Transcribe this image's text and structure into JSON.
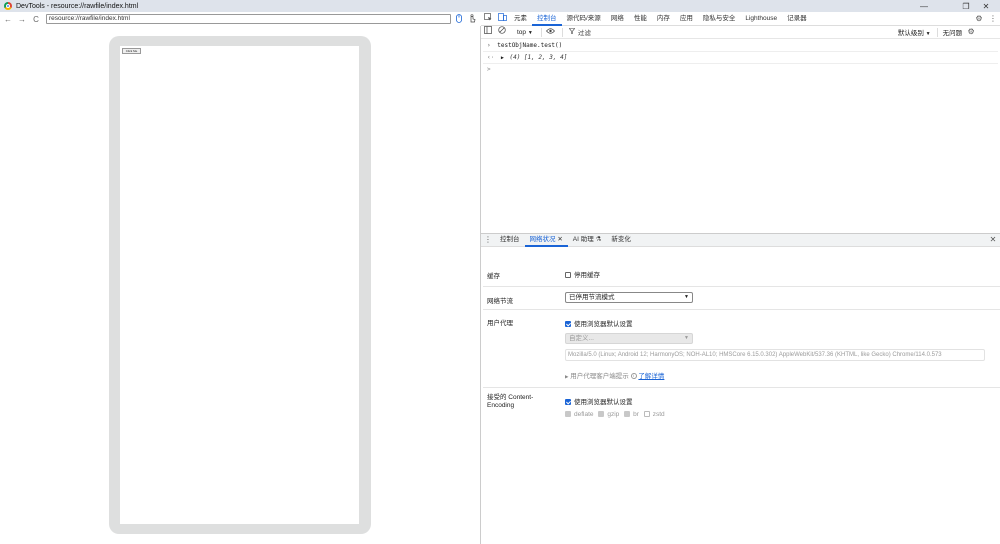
{
  "window": {
    "title": "DevTools - resource://rawfile/index.html",
    "controls": {
      "minimize": "—",
      "restore": "❐",
      "close": "✕"
    }
  },
  "address_bar": {
    "back": "←",
    "forward": "→",
    "reload": "C",
    "url": "resource://rawfile/index.html"
  },
  "preview": {
    "button_label": "Click Me"
  },
  "devtools": {
    "tabs": [
      "元素",
      "控制台",
      "源代码/来源",
      "网络",
      "性能",
      "内存",
      "应用",
      "隐私与安全",
      "Lighthouse",
      "记录器"
    ],
    "active_tab": "控制台",
    "console_toolbar": {
      "context": "top",
      "filter_placeholder": "过滤",
      "level": "默认级别",
      "issues": "无问题"
    },
    "console": {
      "input_line": "testObjName.test()",
      "result_line": "(4) [1, 2, 3, 4]",
      "prompt": ">"
    },
    "drawer_tabs": [
      "控制台",
      "网络状况",
      "AI 助理",
      "新变化"
    ],
    "drawer_active_tab": "网络状况",
    "network_conditions": {
      "cache_label": "缓存",
      "disable_cache": "停用缓存",
      "throttling_label": "网络节流",
      "throttling_value": "已停用节流模式",
      "ua_label": "用户代理",
      "use_browser_default": "使用浏览器默认设置",
      "custom_placeholder": "自定义...",
      "ua_string": "Mozilla/5.0 (Linux; Android 12; HarmonyOS; NOH-AL10; HMSCore 6.15.0.302) AppleWebKit/537.36 (KHTML, like Gecko) Chrome/114.0.573",
      "client_hints": "用户代理客户端提示",
      "learn_more": "了解详情",
      "encoding_label": "接受的 Content-Encoding",
      "encoding_default": "使用浏览器默认设置",
      "encodings": [
        "deflate",
        "gzip",
        "br",
        "zstd"
      ]
    }
  }
}
